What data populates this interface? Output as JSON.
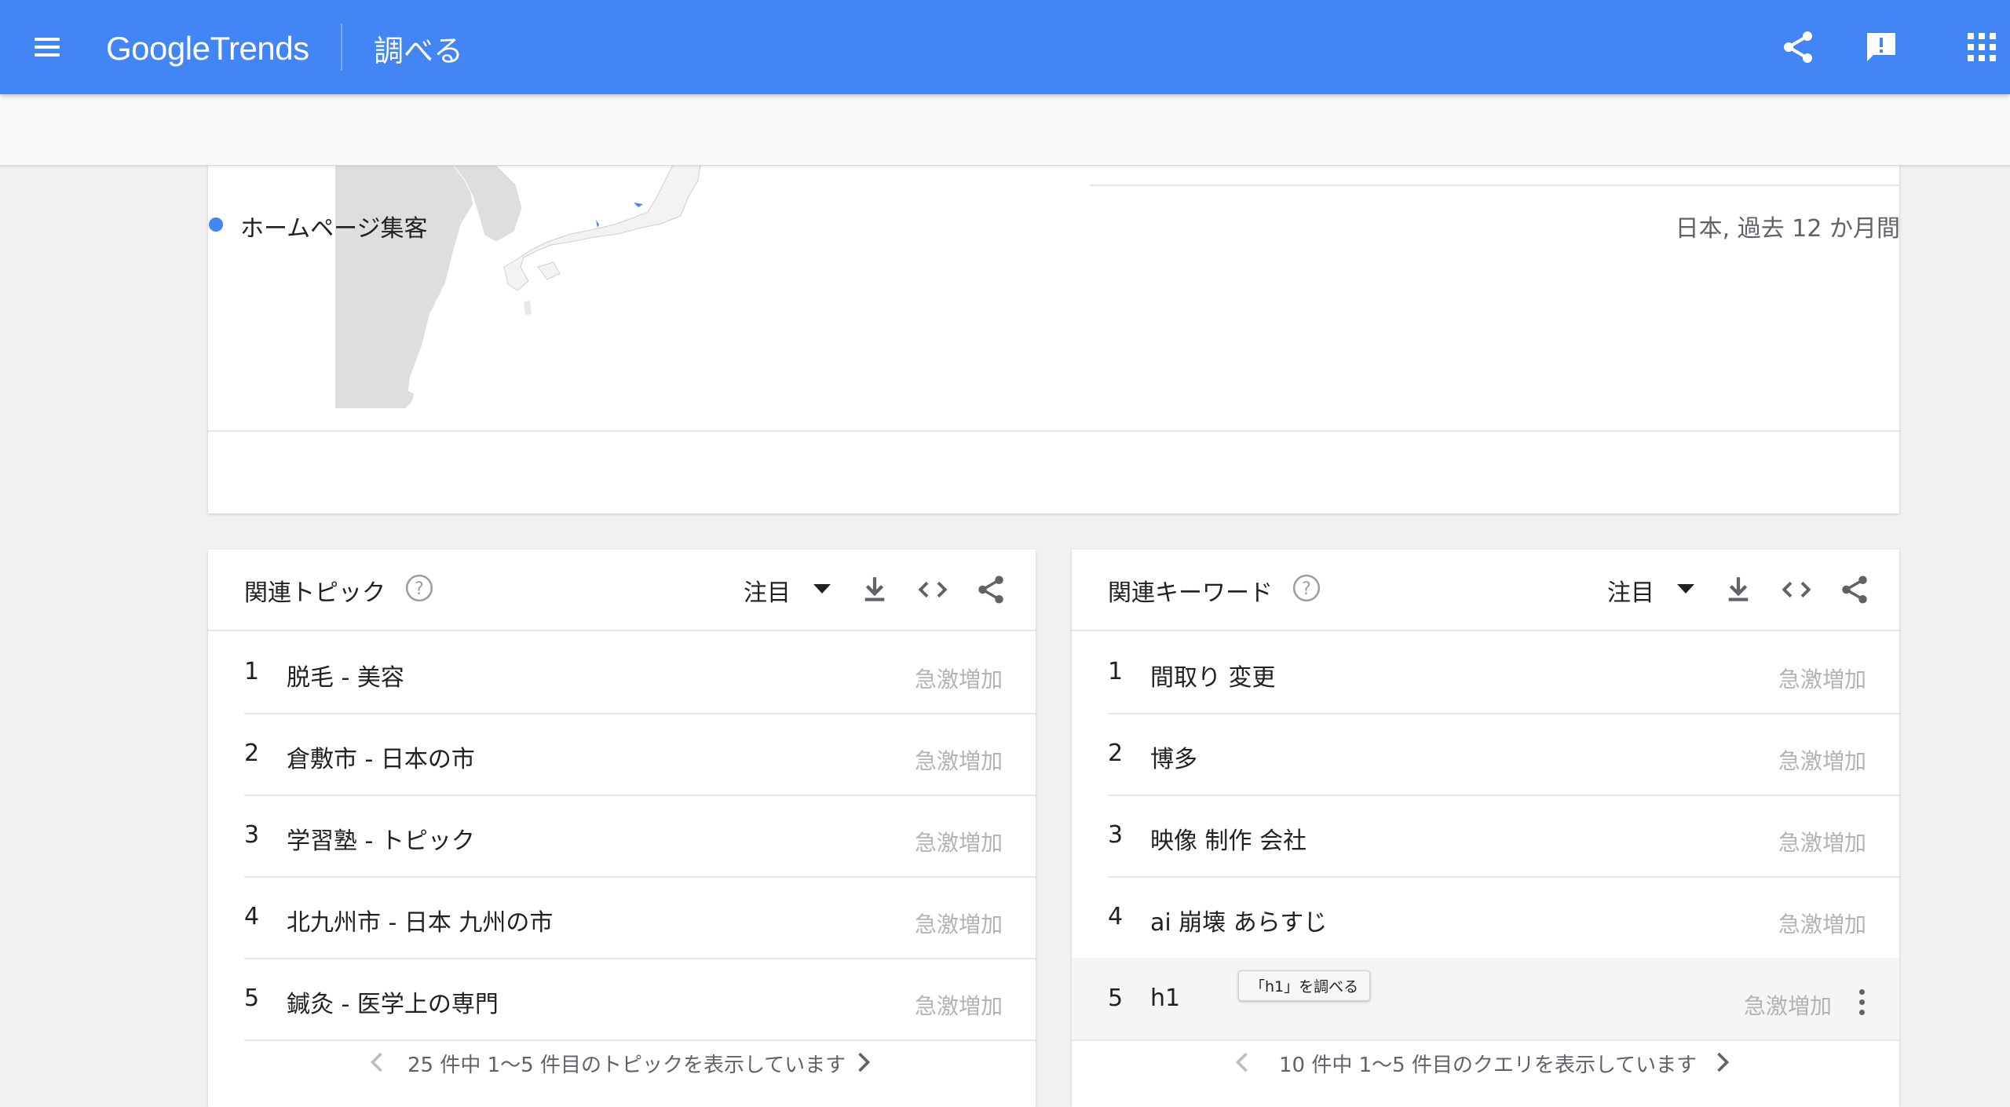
{
  "header": {
    "logo_google": "Google",
    "logo_trends": "Trends",
    "page_title": "調べる",
    "icons": [
      "menu-icon",
      "share-icon",
      "feedback-icon",
      "apps-icon"
    ]
  },
  "subheader": {
    "term": "ホームページ集客",
    "term_color": "#4285f4",
    "range": "日本, 過去 12 か月間"
  },
  "related_topics": {
    "title": "関連トピック",
    "filter": "注目",
    "items": [
      {
        "rank": "1",
        "label": "脱毛 - 美容",
        "value": "急激増加"
      },
      {
        "rank": "2",
        "label": "倉敷市 - 日本の市",
        "value": "急激増加"
      },
      {
        "rank": "3",
        "label": "学習塾 - トピック",
        "value": "急激増加"
      },
      {
        "rank": "4",
        "label": "北九州市 - 日本 九州の市",
        "value": "急激増加"
      },
      {
        "rank": "5",
        "label": "鍼灸 - 医学上の専門",
        "value": "急激増加"
      }
    ],
    "pager": "25 件中 1〜5 件目のトピックを表示しています"
  },
  "related_queries": {
    "title": "関連キーワード",
    "filter": "注目",
    "items": [
      {
        "rank": "1",
        "label": "間取り 変更",
        "value": "急激増加"
      },
      {
        "rank": "2",
        "label": "博多",
        "value": "急激増加"
      },
      {
        "rank": "3",
        "label": "映像 制作 会社",
        "value": "急激増加"
      },
      {
        "rank": "4",
        "label": "ai 崩壊 あらすじ",
        "value": "急激増加"
      },
      {
        "rank": "5",
        "label": "h1",
        "value": "急激増加"
      }
    ],
    "tooltip": "「h1」を調べる",
    "pager": "10 件中 1〜5 件目のクエリを表示しています"
  },
  "colors": {
    "appbar": "#4285f4",
    "value_text": "#b3b3b3"
  }
}
